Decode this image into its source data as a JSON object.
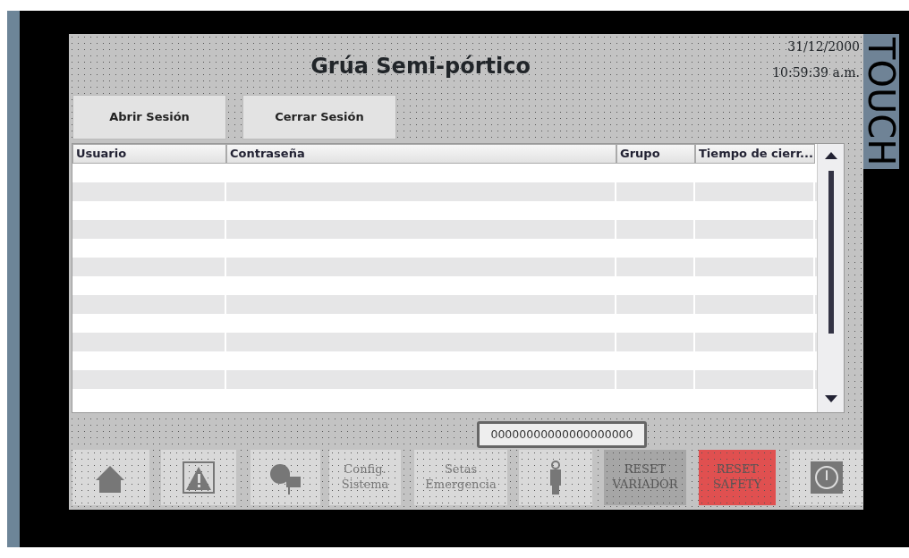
{
  "screen": {
    "title": "Grúa Semi-pórtico",
    "date": "31/12/2000",
    "time": "10:59:39 a.m."
  },
  "brand": "TOUCH",
  "session_buttons": [
    "Abrir Sesión",
    "Cerrar Sesión"
  ],
  "table": {
    "columns": [
      "Usuario",
      "Contraseña",
      "Grupo",
      "Tiempo de cierr..."
    ]
  },
  "output_field": {
    "value": "00000000000000000000"
  },
  "nav_buttons": [
    {
      "kind": "icon"
    },
    {
      "kind": "icon"
    },
    {
      "kind": "icon"
    },
    {
      "kind": "text",
      "label": "Config.\nSistema"
    },
    {
      "kind": "text",
      "label": "Setas\nEmergencia"
    },
    {
      "kind": "icon"
    },
    {
      "kind": "reset",
      "label": "RESET\nVARIADOR",
      "color": "#a6a6a6"
    },
    {
      "kind": "reset",
      "label": "RESET\nSAFETY",
      "color": "#e05050"
    },
    {
      "kind": "icon"
    }
  ]
}
